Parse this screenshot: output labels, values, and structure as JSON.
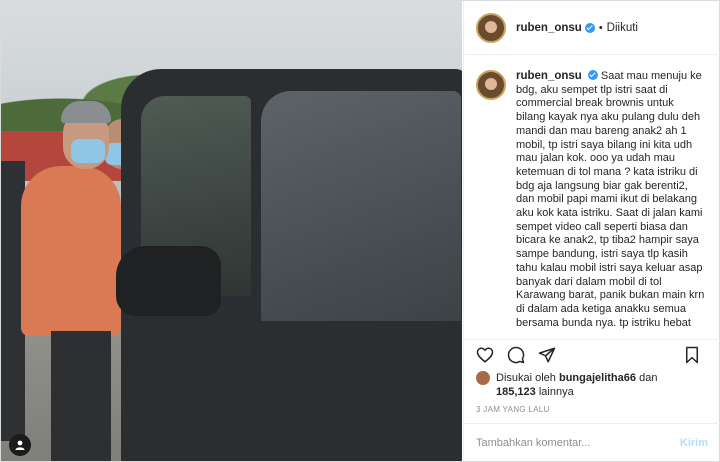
{
  "post": {
    "username": "ruben_onsu",
    "follow_status": "Diikuti",
    "separator": "•",
    "caption": "Saat mau menuju ke bdg, aku sempet tlp istri saat di commercial break brownis untuk bilang kayak nya aku pulang dulu deh mandi dan mau bareng anak2 ah 1 mobil, tp istri saya bilang ini kita udh mau jalan kok. ooo ya udah mau ketemuan di tol mana ? kata istriku di bdg aja langsung biar gak berenti2, dan mobil papi mami ikut di belakang aku kok kata istriku. Saat di jalan kami sempet video call seperti biasa dan bicara ke anak2, tp tiba2 hampir saya sampe bandung, istri saya tlp kasih tahu kalau mobil istri saya keluar asap banyak dari dalam mobil di tol Karawang barat, panik bukan main krn di dalam ada ketiga anakku semua bersama bunda nya. tp istriku hebat",
    "likes_prefix": "Disukai oleh",
    "liked_by": "bungajelitha66",
    "likes_and": "dan",
    "likes_count": "185,123",
    "likes_suffix": "lainnya",
    "timestamp": "3 JAM YANG LALU"
  },
  "comment": {
    "placeholder": "Tambahkan komentar...",
    "send_label": "Kirim"
  },
  "icons": {
    "like": "heart-icon",
    "comment": "comment-icon",
    "share": "share-icon",
    "save": "bookmark-icon",
    "tag": "user-tag-icon"
  },
  "colors": {
    "verified": "#3897f0",
    "send_disabled": "#b2dffc",
    "muted": "#8e8e8e"
  }
}
